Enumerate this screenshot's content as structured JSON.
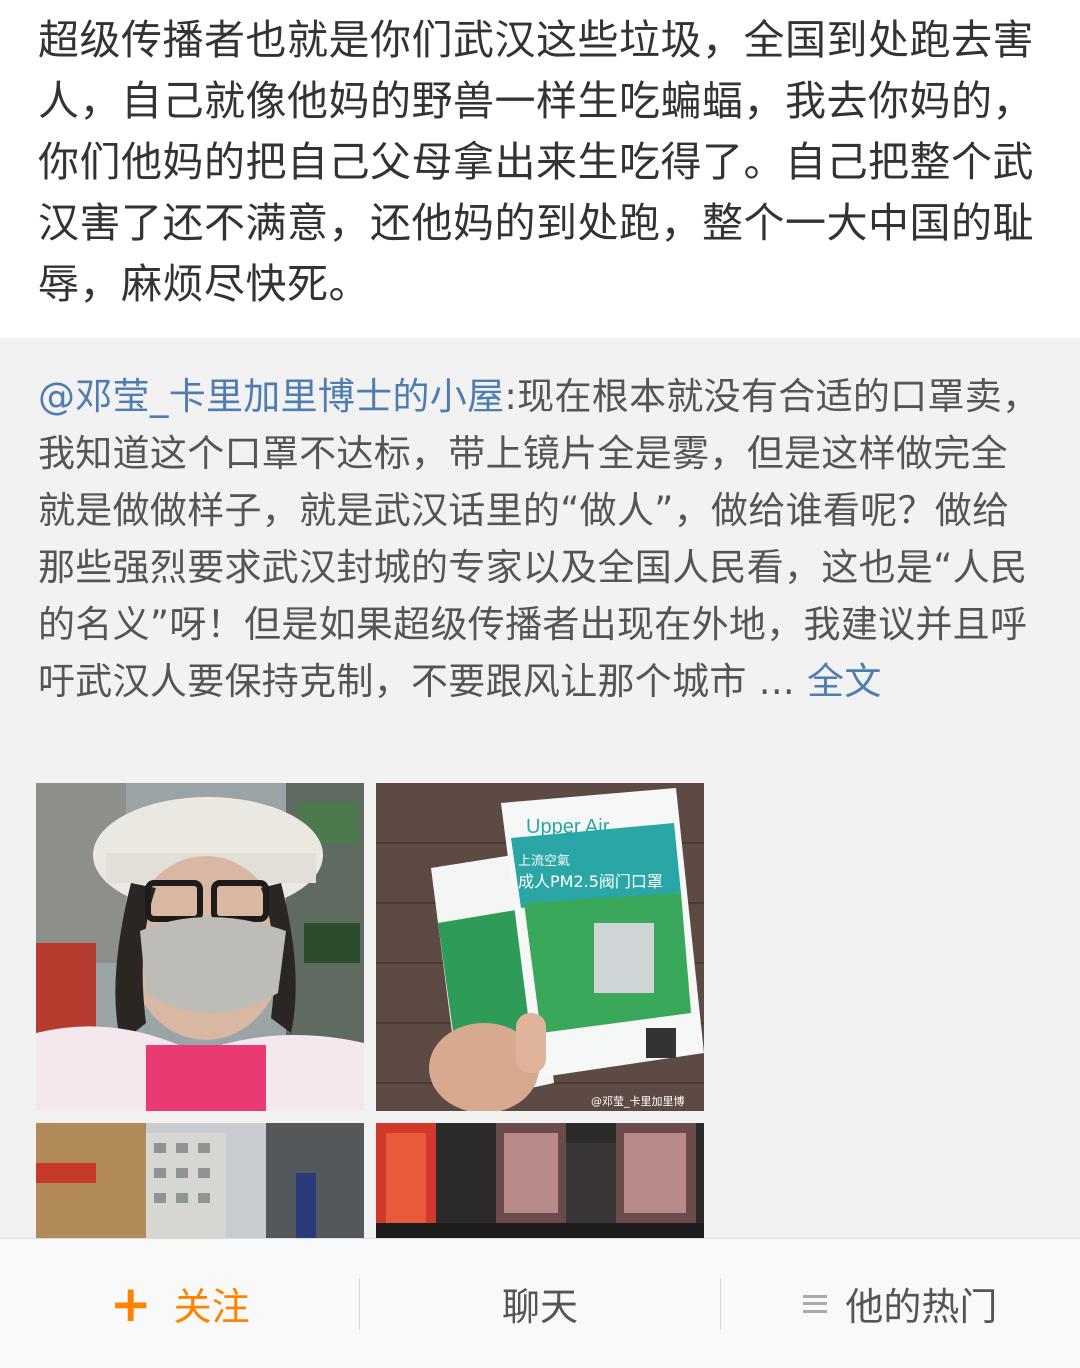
{
  "post": {
    "text": "超级传播者也就是你们武汉这些垃圾，全国到处跑去害人，自己就像他妈的野兽一样生吃蝙蝠，我去你妈的，你们他妈的把自己父母拿出来生吃得了。自己把整个武汉害了还不满意，还他妈的到处跑，整个一大中国的耻辱，麻烦尽快死。"
  },
  "repost": {
    "mention": "@邓莹_卡里加里博士的小屋",
    "text": ":现在根本就没有合适的口罩卖，我知道这个口罩不达标，带上镜片全是雾，但是这样做完全就是做做样子，就是武汉话里的“做人”，做给谁看呢？做给那些强烈要求武汉封城的专家以及全国人民看，这也是“人民的名义”呀！但是如果超级传播者出现在外地，我建议并且呼吁武汉人要保持克制，不要跟风让那个城市 ...",
    "more_link": "全文",
    "images": {
      "img1": {
        "name": "selfie-with-mask-photo"
      },
      "img2": {
        "name": "mask-package-photo",
        "brand": "Upper Air",
        "brand_cn": "上流空氣",
        "product": "成人PM2.5阀门口罩",
        "watermark": "@邓莹_卡里加里博"
      },
      "img3": {
        "name": "street-buildings-photo"
      },
      "img4": {
        "name": "storefront-photo"
      }
    }
  },
  "bottom_bar": {
    "follow_label": "关注",
    "chat_label": "聊天",
    "hot_label": "他的热门"
  },
  "colors": {
    "link": "#507daf",
    "accent": "#ff8200",
    "repost_bg": "#f2f2f2"
  }
}
